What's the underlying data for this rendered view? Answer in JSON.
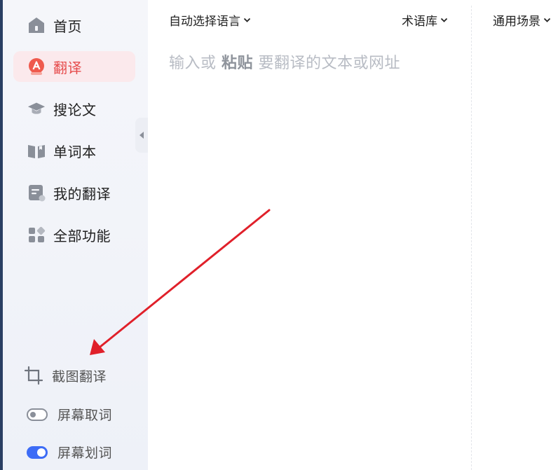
{
  "sidebar": {
    "nav": [
      {
        "label": "首页",
        "icon": "home-icon",
        "active": false
      },
      {
        "label": "翻译",
        "icon": "translate-icon",
        "active": true
      },
      {
        "label": "搜论文",
        "icon": "graduation-cap-icon",
        "active": false
      },
      {
        "label": "单词本",
        "icon": "book-icon",
        "active": false
      },
      {
        "label": "我的翻译",
        "icon": "document-icon",
        "active": false
      },
      {
        "label": "全部功能",
        "icon": "grid-icon",
        "active": false
      }
    ],
    "tools": {
      "screenshot_translate": "截图翻译",
      "screen_capture_word": "屏幕取词",
      "screen_select_word": "屏幕划词"
    },
    "toggles": {
      "screen_capture_word_on": false,
      "screen_select_word_on": true
    }
  },
  "toolbar": {
    "language": "自动选择语言",
    "termbase": "术语库",
    "scene": "通用场景"
  },
  "editor": {
    "placeholder_prefix": "输入或",
    "placeholder_emph": "粘贴",
    "placeholder_suffix": "要翻译的文本或网址"
  },
  "colors": {
    "accent": "#e64b4b",
    "active_bg": "#fbe9ec",
    "toggle_on": "#3d6cf6",
    "annotation_arrow": "#e0202a"
  }
}
